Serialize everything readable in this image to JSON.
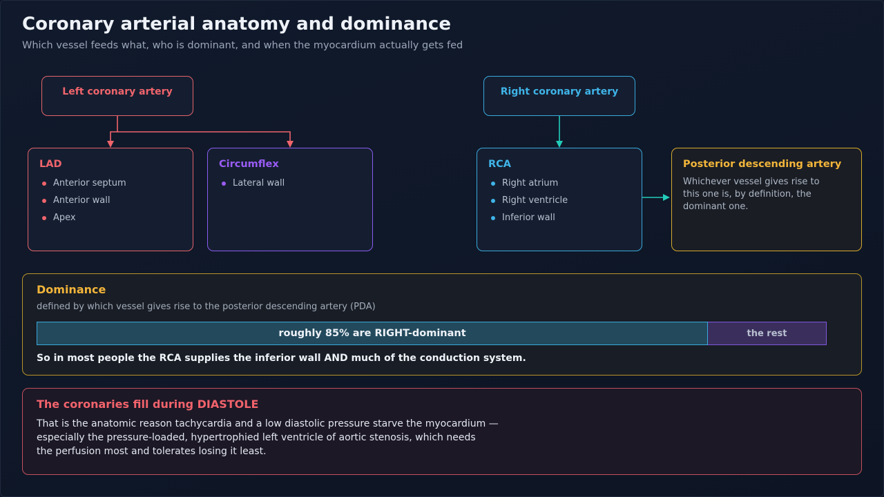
{
  "header": {
    "title": "Coronary arterial anatomy and dominance",
    "subtitle": "Which vessel feeds what, who is dominant, and when the myocardium actually gets fed"
  },
  "colors": {
    "left": "#f0646c",
    "lad": "#f0646c",
    "circumflex": "#9a5cf6",
    "right": "#3fb4e8",
    "pda": "#f2b53a",
    "rca_arrow": "#22ccbb"
  },
  "diagram": {
    "left_coronary": {
      "label": "Left coronary artery"
    },
    "right_coronary": {
      "label": "Right coronary artery"
    },
    "lad": {
      "title": "LAD",
      "items": [
        "Anterior septum",
        "Anterior wall",
        "Apex"
      ]
    },
    "circumflex": {
      "title": "Circumflex",
      "items": [
        "Lateral wall"
      ]
    },
    "rca": {
      "title": "RCA",
      "items": [
        "Right atrium",
        "Right ventricle",
        "Inferior wall"
      ]
    },
    "pda": {
      "title": "Posterior descending artery",
      "description": "Whichever vessel gives rise to this one is, by definition, the dominant one."
    }
  },
  "dominance": {
    "title": "Dominance",
    "subtitle": "defined by which vessel gives rise to the posterior descending artery (PDA)",
    "right_dominant_fraction": 0.85,
    "main_label": "roughly 85% are RIGHT-dominant",
    "rest_label": "the rest",
    "note": "So in most people the RCA supplies the inferior wall AND much of the conduction system."
  },
  "diastole": {
    "title": "The coronaries fill during DIASTOLE",
    "lines": [
      "That is the anatomic reason tachycardia and a low diastolic pressure starve the myocardium —",
      "especially the pressure-loaded, hypertrophied left ventricle of aortic stenosis, which needs",
      "the perfusion most and tolerates losing it least."
    ]
  }
}
